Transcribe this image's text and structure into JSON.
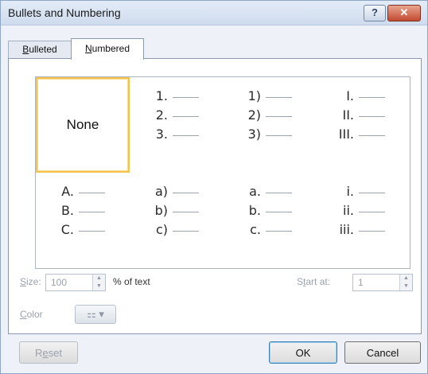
{
  "dialog": {
    "title": "Bullets and Numbering",
    "help_label": "?",
    "close_label": "✕"
  },
  "tabs": [
    {
      "label_accel": "B",
      "label_rest": "ulleted",
      "active": false
    },
    {
      "label_accel": "N",
      "label_rest": "umbered",
      "active": true
    }
  ],
  "gallery": {
    "none_label": "None",
    "cells": [
      [
        "1.",
        "2.",
        "3."
      ],
      [
        "1)",
        "2)",
        "3)"
      ],
      [
        "I.",
        "II.",
        "III."
      ],
      [
        "A.",
        "B.",
        "C."
      ],
      [
        "a)",
        "b)",
        "c)"
      ],
      [
        "a.",
        "b.",
        "c."
      ],
      [
        "i.",
        "ii.",
        "iii."
      ]
    ]
  },
  "size": {
    "accel": "S",
    "rest": "ize:",
    "value": "100",
    "suffix": "% of text"
  },
  "start": {
    "pre": "S",
    "accel": "t",
    "rest": "art at:",
    "value": "1"
  },
  "color": {
    "accel": "C",
    "rest": "olor",
    "icon": "paint-bucket-icon"
  },
  "buttons": {
    "reset_pre": "R",
    "reset_accel": "e",
    "reset_rest": "set",
    "ok": "OK",
    "cancel": "Cancel"
  },
  "colors": {
    "selection": "#f6c24c",
    "title_bar": "#cfdcee",
    "close": "#c24a31"
  }
}
